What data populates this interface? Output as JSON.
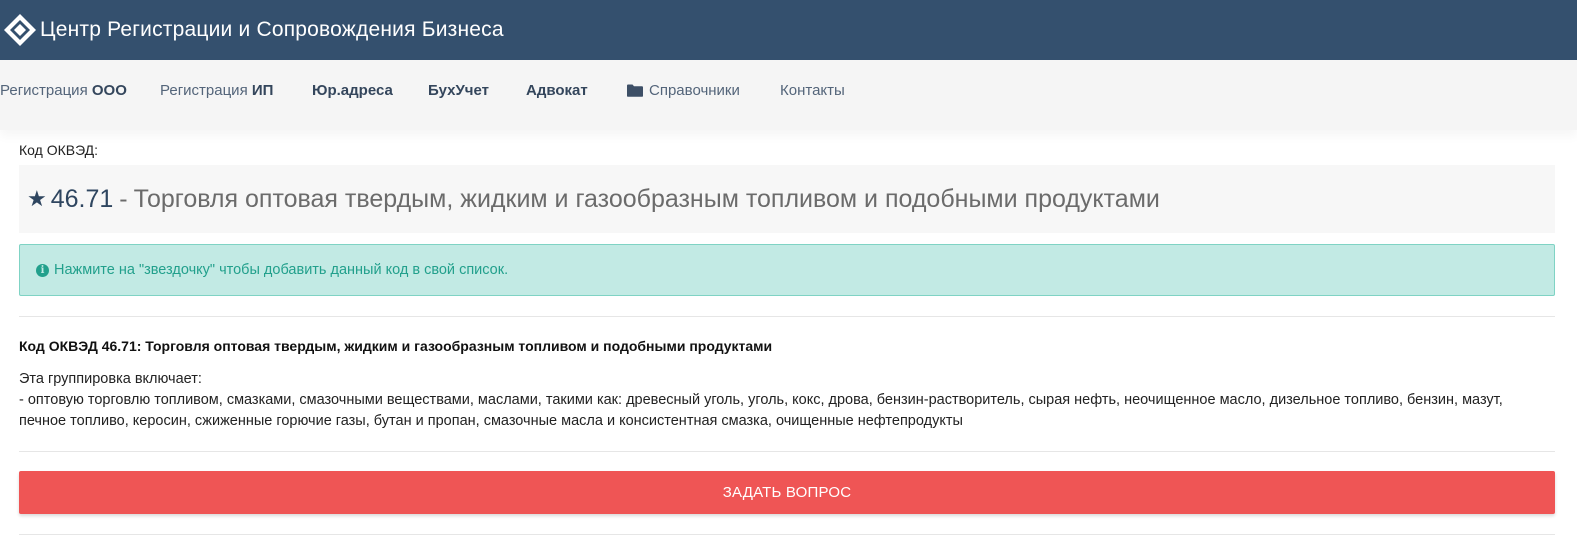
{
  "header": {
    "brand": "Центр Регистрации и Сопровождения Бизнеса",
    "logo_icon": "diamond-logo-icon",
    "background": "#34506e"
  },
  "nav": {
    "items": [
      {
        "prefix": "Регистрация ",
        "bold": "ООО"
      },
      {
        "prefix": "Регистрация ",
        "bold": "ИП"
      },
      {
        "label": "Юр.адреса"
      },
      {
        "label": "БухУчет"
      },
      {
        "label": "Адвокат"
      },
      {
        "label": "Справочники",
        "icon": "folder-icon"
      },
      {
        "label": "Контакты"
      }
    ]
  },
  "okved": {
    "field_label": "Код ОКВЭД:",
    "star_icon": "★",
    "code": "46.71",
    "separator": "-",
    "title": "Торговля оптовая твердым, жидким и газообразным топливом и подобными продуктами"
  },
  "alert": {
    "icon": "info-icon",
    "text": "Нажмите на \"звездочку\" чтобы добавить данный код в свой список.",
    "color": "#22a08c",
    "background": "#c2eae4"
  },
  "description": {
    "heading": "Код ОКВЭД 46.71: Торговля оптовая твердым, жидким и газообразным топливом и подобными продуктами",
    "intro": "Эта группировка включает:",
    "body": "- оптовую торговлю топливом, смазками, смазочными веществами, маслами, такими как: древесный уголь, уголь, кокс, дрова, бензин-растворитель, сырая нефть, неочищенное масло, дизельное топливо, бензин, мазут, печное топливо, керосин, сжиженные горючие газы, бутан и пропан, смазочные масла и консистентная смазка, очищенные нефтепродукты"
  },
  "actions": {
    "ask_label": "ЗАДАТЬ ВОПРОС",
    "ask_color": "#ef5555"
  }
}
